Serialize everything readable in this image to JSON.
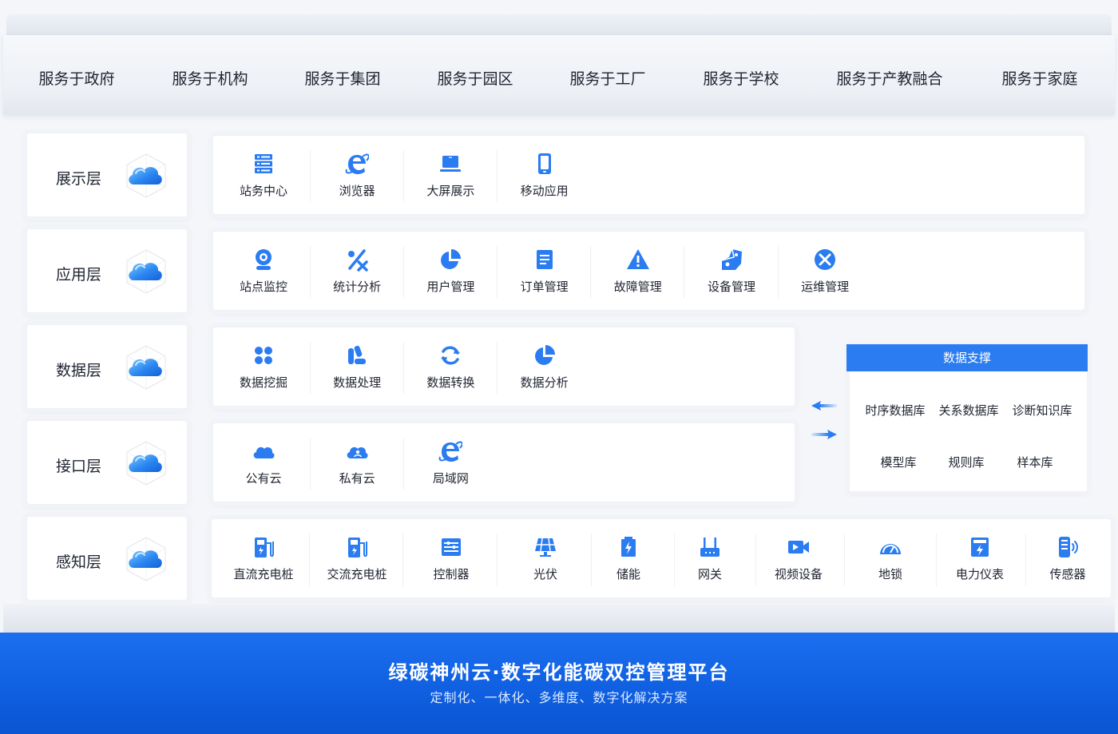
{
  "services": [
    "服务于政府",
    "服务于机构",
    "服务于集团",
    "服务于园区",
    "服务于工厂",
    "服务于学校",
    "服务于产教融合",
    "服务于家庭"
  ],
  "layers": [
    {
      "name": "展示层",
      "items": [
        {
          "label": "站务中心",
          "icon": "server-icon"
        },
        {
          "label": "浏览器",
          "icon": "browser-e-icon"
        },
        {
          "label": "大屏展示",
          "icon": "laptop-icon"
        },
        {
          "label": "移动应用",
          "icon": "phone-icon"
        }
      ]
    },
    {
      "name": "应用层",
      "items": [
        {
          "label": "站点监控",
          "icon": "webcam-icon"
        },
        {
          "label": "统计分析",
          "icon": "percent-icon"
        },
        {
          "label": "用户管理",
          "icon": "pie-icon"
        },
        {
          "label": "订单管理",
          "icon": "document-icon"
        },
        {
          "label": "故障管理",
          "icon": "warning-icon"
        },
        {
          "label": "设备管理",
          "icon": "device-icon"
        },
        {
          "label": "运维管理",
          "icon": "tools-icon"
        }
      ]
    },
    {
      "name": "数据层",
      "items": [
        {
          "label": "数据挖掘",
          "icon": "grid-dots-icon"
        },
        {
          "label": "数据处理",
          "icon": "process-icon"
        },
        {
          "label": "数据转换",
          "icon": "refresh-icon"
        },
        {
          "label": "数据分析",
          "icon": "pie-icon"
        }
      ]
    },
    {
      "name": "接口层",
      "items": [
        {
          "label": "公有云",
          "icon": "cloud-icon"
        },
        {
          "label": "私有云",
          "icon": "private-cloud-icon"
        },
        {
          "label": "局域网",
          "icon": "browser-e-icon"
        }
      ]
    },
    {
      "name": "感知层",
      "items": [
        {
          "label": "直流充电桩",
          "icon": "charger-icon"
        },
        {
          "label": "交流充电桩",
          "icon": "charger-icon"
        },
        {
          "label": "控制器",
          "icon": "controller-icon"
        },
        {
          "label": "光伏",
          "icon": "solar-panel-icon"
        },
        {
          "label": "储能",
          "icon": "battery-icon"
        },
        {
          "label": "网关",
          "icon": "router-icon"
        },
        {
          "label": "视频设备",
          "icon": "video-camera-icon"
        },
        {
          "label": "地锁",
          "icon": "gauge-icon"
        },
        {
          "label": "电力仪表",
          "icon": "meter-icon"
        },
        {
          "label": "传感器",
          "icon": "sensor-icon"
        }
      ]
    }
  ],
  "data_support": {
    "title": "数据支撑",
    "row1": [
      "时序数据库",
      "关系数据库",
      "诊断知识库"
    ],
    "row2": [
      "模型库",
      "规则库",
      "样本库"
    ]
  },
  "footer": {
    "title": "绿碳神州云·数字化能碳双控管理平台",
    "subtitle": "定制化、一体化、多维度、数字化解决方案"
  },
  "colors": {
    "accent": "#2a7cf0",
    "footer": "#1565e6"
  }
}
